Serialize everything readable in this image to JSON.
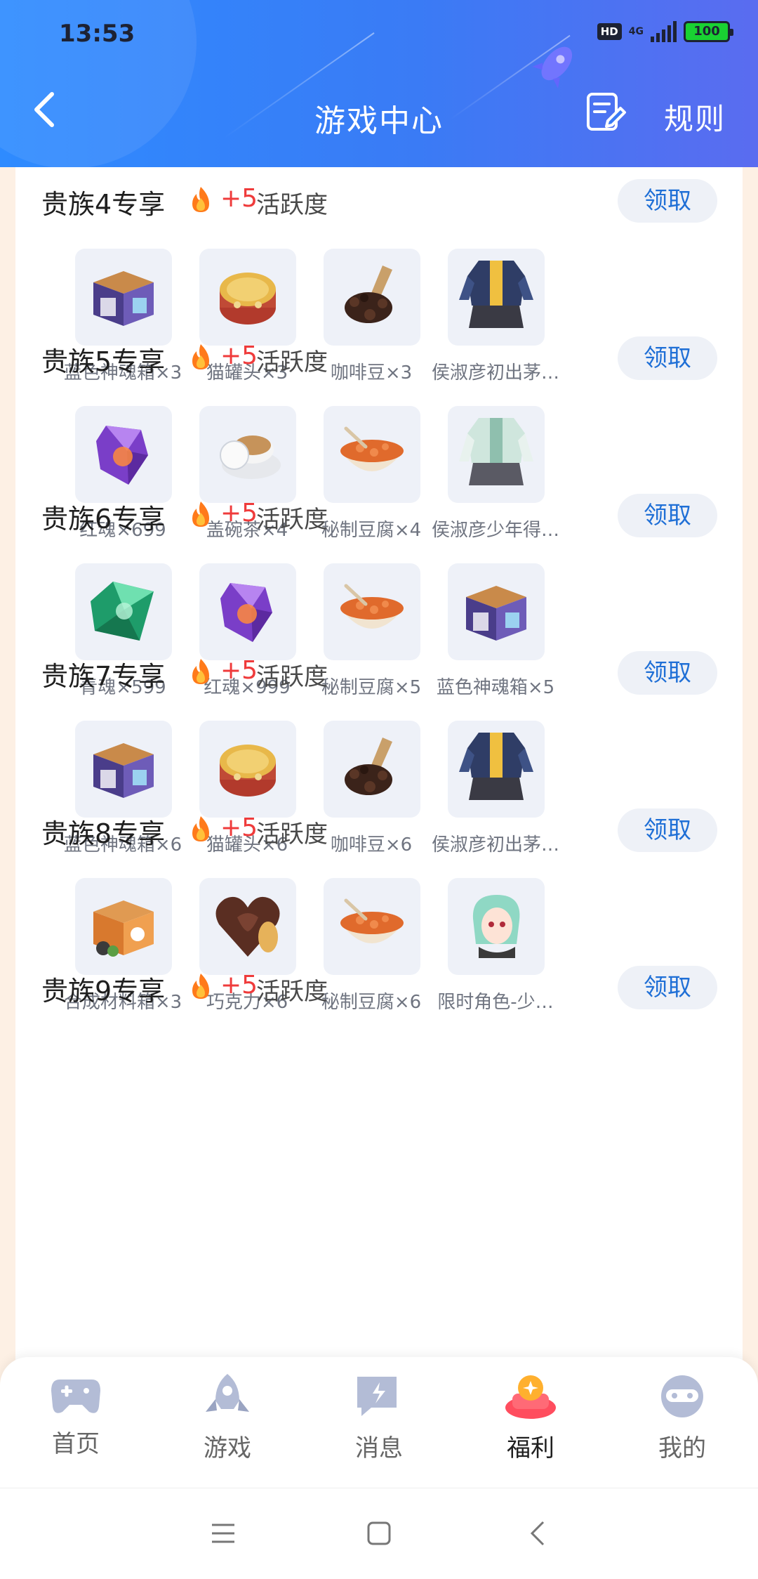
{
  "status_bar": {
    "time": "13:53",
    "hd": "HD",
    "network": "4G",
    "battery": "100"
  },
  "header": {
    "title": "游戏中心",
    "rules": "规则"
  },
  "sections": [
    {
      "title": "贵族4专享",
      "points": "+5",
      "points_label": "活跃度",
      "claim": "领取",
      "items": [
        {
          "label": "蓝色神魂箱×3",
          "icon": "blue-box"
        },
        {
          "label": "猫罐头×3",
          "icon": "cat-can"
        },
        {
          "label": "咖啡豆×3",
          "icon": "coffee-beans"
        },
        {
          "label": "侯淑彦初出茅…",
          "icon": "outfit-dark"
        }
      ]
    },
    {
      "title": "贵族5专享",
      "points": "+5",
      "points_label": "活跃度",
      "claim": "领取",
      "items": [
        {
          "label": "红魂×699",
          "icon": "purple-crystal"
        },
        {
          "label": "盖碗茶×4",
          "icon": "tea-cup"
        },
        {
          "label": "秘制豆腐×4",
          "icon": "tofu-bowl"
        },
        {
          "label": "侯淑彦少年得…",
          "icon": "outfit-light"
        }
      ]
    },
    {
      "title": "贵族6专享",
      "points": "+5",
      "points_label": "活跃度",
      "claim": "领取",
      "items": [
        {
          "label": "青魂×599",
          "icon": "green-crystal"
        },
        {
          "label": "红魂×999",
          "icon": "purple-crystal"
        },
        {
          "label": "秘制豆腐×5",
          "icon": "tofu-bowl"
        },
        {
          "label": "蓝色神魂箱×5",
          "icon": "blue-box"
        }
      ]
    },
    {
      "title": "贵族7专享",
      "points": "+5",
      "points_label": "活跃度",
      "claim": "领取",
      "items": [
        {
          "label": "蓝色神魂箱×6",
          "icon": "blue-box"
        },
        {
          "label": "猫罐头×6",
          "icon": "cat-can"
        },
        {
          "label": "咖啡豆×6",
          "icon": "coffee-beans"
        },
        {
          "label": "侯淑彦初出茅…",
          "icon": "outfit-dark"
        }
      ]
    },
    {
      "title": "贵族8专享",
      "points": "+5",
      "points_label": "活跃度",
      "claim": "领取",
      "items": [
        {
          "label": "合成材料箱×3",
          "icon": "orange-box"
        },
        {
          "label": "巧克力×6",
          "icon": "chocolate-heart"
        },
        {
          "label": "秘制豆腐×6",
          "icon": "tofu-bowl"
        },
        {
          "label": "限时角色-少…",
          "icon": "character-portrait"
        }
      ]
    },
    {
      "title": "贵族9专享",
      "points": "+5",
      "points_label": "活跃度",
      "claim": "领取",
      "items": []
    }
  ],
  "tabs": [
    {
      "label": "首页",
      "icon": "gamepad-icon"
    },
    {
      "label": "游戏",
      "icon": "rocket-icon"
    },
    {
      "label": "消息",
      "icon": "message-icon"
    },
    {
      "label": "福利",
      "icon": "gift-icon",
      "active": true
    },
    {
      "label": "我的",
      "icon": "profile-icon"
    }
  ],
  "colors": {
    "header": "#3a7bf5",
    "accent": "#1f6fd6",
    "points": "#ef3b3b",
    "active_tab": "#ff4d5e"
  }
}
